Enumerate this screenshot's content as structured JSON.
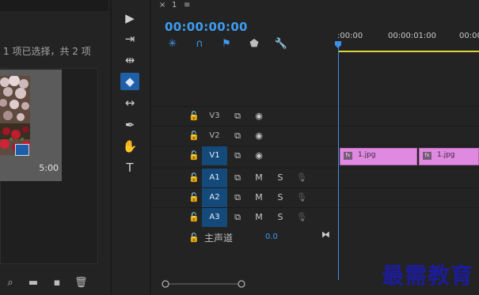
{
  "project": {
    "status_text": "1 项已选择，共 2 项",
    "thumb_duration": "5:00"
  },
  "tools": [
    {
      "icon": "selection-tool-icon"
    },
    {
      "icon": "track-select-tool-icon"
    },
    {
      "icon": "ripple-edit-tool-icon"
    },
    {
      "icon": "razor-tool-icon",
      "active": true
    },
    {
      "icon": "slip-tool-icon"
    },
    {
      "icon": "pen-tool-icon"
    },
    {
      "icon": "hand-tool-icon"
    },
    {
      "icon": "type-tool-icon"
    }
  ],
  "timeline": {
    "tab_close": "×",
    "tab_label": "1",
    "tab_menu": "≡",
    "timecode": "00:00:00:00",
    "ruler_ticks": [
      ":00:00",
      "00:00:01:00",
      "00:00"
    ],
    "tracks": [
      {
        "name": "V3",
        "selected": false
      },
      {
        "name": "V2",
        "selected": false
      },
      {
        "name": "V1",
        "selected": true,
        "clips": [
          "1.jpg",
          "1.jpg"
        ]
      },
      {
        "name": "A1",
        "selected": true,
        "m": "M",
        "s": "S"
      },
      {
        "name": "A2",
        "selected": true,
        "m": "M",
        "s": "S"
      },
      {
        "name": "A3",
        "selected": true,
        "m": "M",
        "s": "S"
      }
    ],
    "master_label": "主声道",
    "master_value": "0.0"
  },
  "watermark": "最需教育",
  "colors": {
    "accent": "#3d9cf0",
    "clip": "#e089e0",
    "selected_track": "#134a7a",
    "work_area": "#e0d23a"
  }
}
